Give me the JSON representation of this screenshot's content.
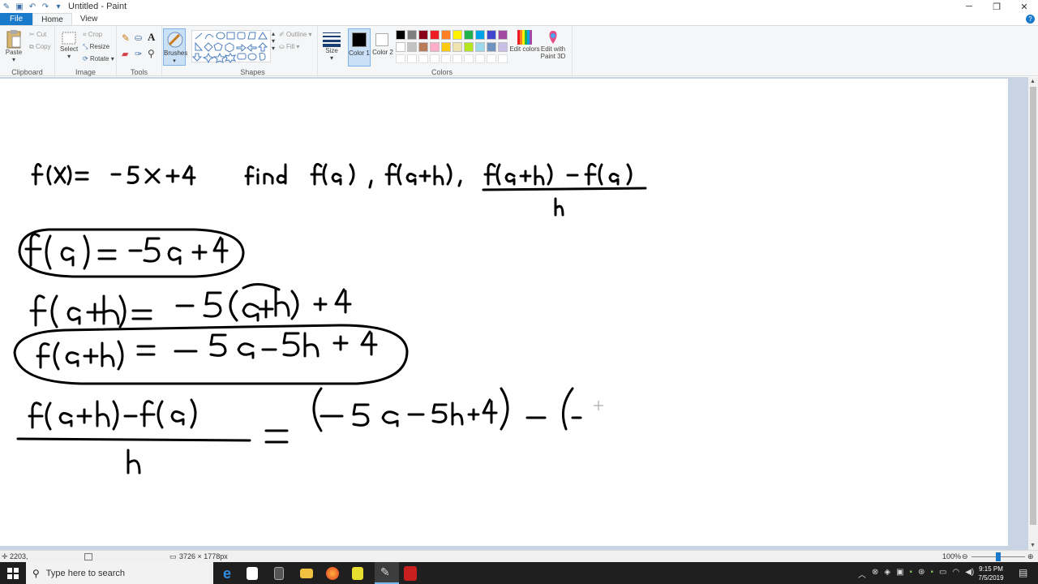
{
  "window": {
    "title": "Untitled - Paint"
  },
  "tabs": [
    "File",
    "Home",
    "View"
  ],
  "ribbon": {
    "clipboard": {
      "paste": "Paste",
      "cut": "Cut",
      "copy": "Copy",
      "label": "Clipboard"
    },
    "image": {
      "select": "Select",
      "crop": "Crop",
      "resize": "Resize",
      "rotate": "Rotate",
      "label": "Image"
    },
    "tools": {
      "label": "Tools"
    },
    "brushes": {
      "label": "Brushes"
    },
    "shapes": {
      "outline": "Outline",
      "fill": "Fill",
      "label": "Shapes"
    },
    "size": {
      "label": "Size"
    },
    "color1": {
      "label": "Color 1"
    },
    "color2": {
      "label": "Color 2"
    },
    "colors": {
      "label": "Colors",
      "edit": "Edit colors",
      "paint3d": "Edit with Paint 3D",
      "row1": [
        "#000000",
        "#7f7f7f",
        "#880015",
        "#ed1c24",
        "#ff7f27",
        "#fff200",
        "#22b14c",
        "#00a2e8",
        "#3f48cc",
        "#a349a4"
      ],
      "row2": [
        "#ffffff",
        "#c3c3c3",
        "#b97a57",
        "#ffaec9",
        "#ffc90e",
        "#efe4b0",
        "#b5e61d",
        "#99d9ea",
        "#7092be",
        "#c8bfe7"
      ]
    }
  },
  "status": {
    "coords": "2203,",
    "size": "3726 × 1778px",
    "zoom": "100%"
  },
  "taskbar": {
    "search_placeholder": "Type here to search",
    "time": "9:15 PM",
    "date": "7/5/2019"
  }
}
